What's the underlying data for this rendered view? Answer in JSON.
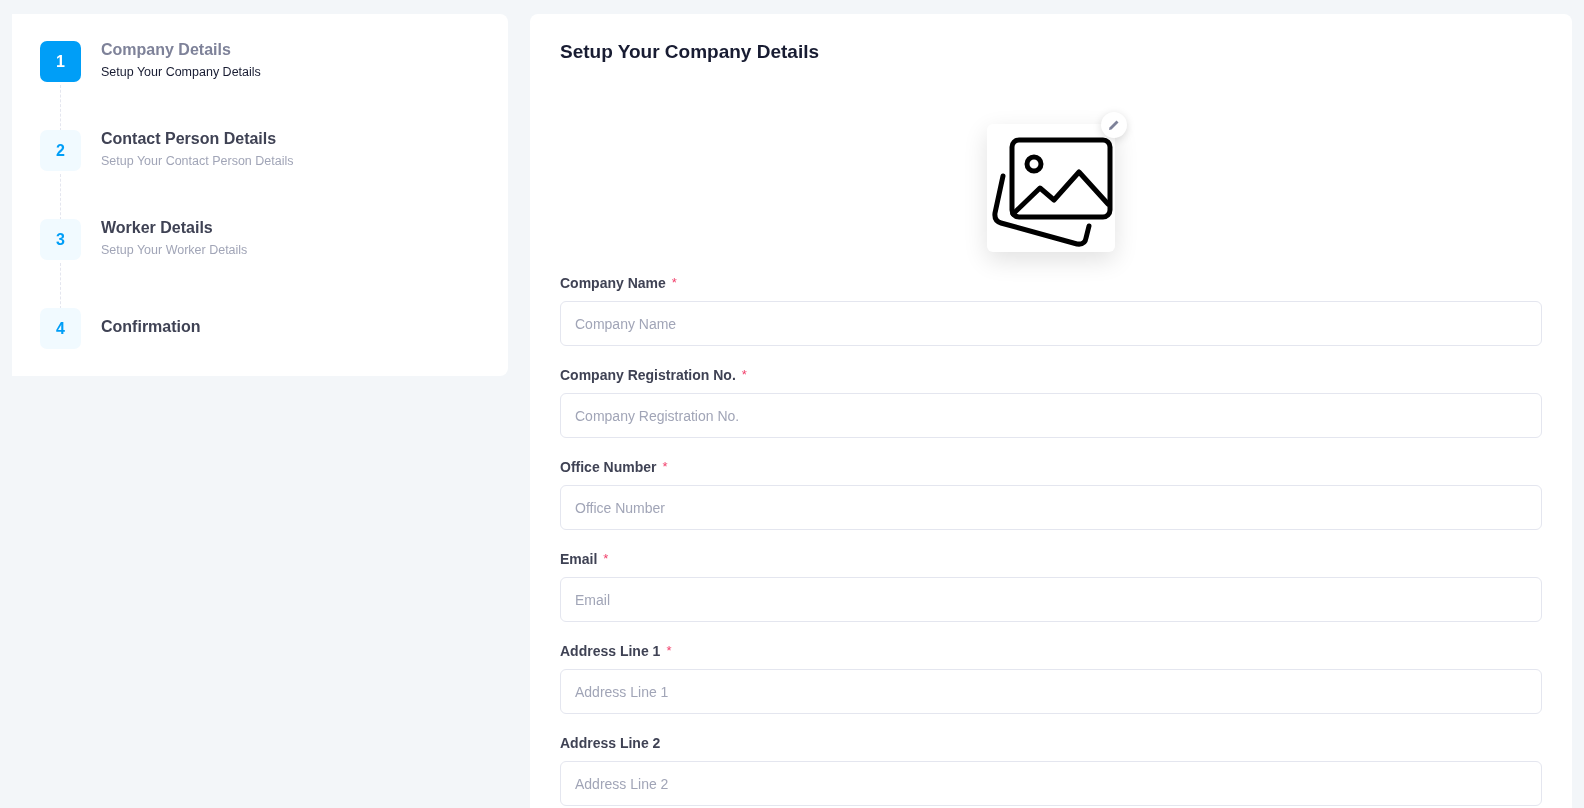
{
  "steps": [
    {
      "number": "1",
      "title": "Company Details",
      "subtitle": "Setup Your Company Details",
      "selected": true
    },
    {
      "number": "2",
      "title": "Contact Person Details",
      "subtitle": "Setup Your Contact Person Details",
      "selected": false
    },
    {
      "number": "3",
      "title": "Worker Details",
      "subtitle": "Setup Your Worker Details",
      "selected": false
    },
    {
      "number": "4",
      "title": "Confirmation",
      "selected": false
    }
  ],
  "form": {
    "title": "Setup Your Company Details",
    "fields": [
      {
        "label": "Company Name",
        "required_mark": "*",
        "placeholder": "Company Name"
      },
      {
        "label": "Company Registration No.",
        "required_mark": "*",
        "placeholder": "Company Registration No."
      },
      {
        "label": "Office Number",
        "required_mark": "*",
        "placeholder": "Office Number"
      },
      {
        "label": "Email",
        "required_mark": "*",
        "placeholder": "Email"
      },
      {
        "label": "Address Line 1",
        "required_mark": "*",
        "placeholder": "Address Line 1"
      },
      {
        "label": "Address Line 2",
        "placeholder": "Address Line 2"
      }
    ]
  }
}
